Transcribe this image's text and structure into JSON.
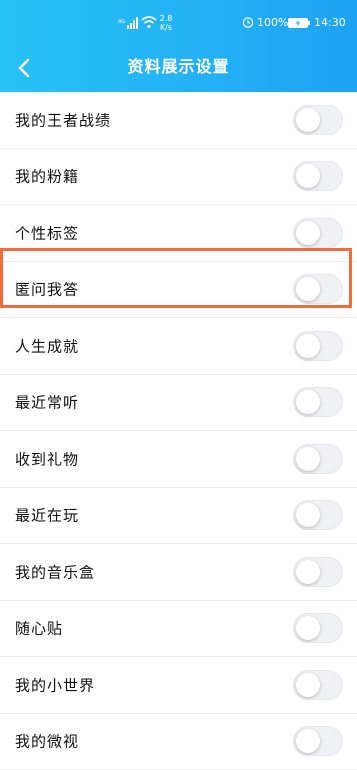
{
  "status_bar": {
    "speed_value": "2.8",
    "speed_unit": "K/s",
    "battery_percent": "100%",
    "time": "14:30"
  },
  "nav": {
    "title": "资料展示设置",
    "back_icon": "chevron-left-icon"
  },
  "settings": [
    {
      "label": "我的王者战绩",
      "enabled": false
    },
    {
      "label": "我的粉籍",
      "enabled": false
    },
    {
      "label": "个性标签",
      "enabled": false
    },
    {
      "label": "匿问我答",
      "enabled": false
    },
    {
      "label": "人生成就",
      "enabled": false
    },
    {
      "label": "最近常听",
      "enabled": false
    },
    {
      "label": "收到礼物",
      "enabled": false
    },
    {
      "label": "最近在玩",
      "enabled": false
    },
    {
      "label": "我的音乐盒",
      "enabled": false
    },
    {
      "label": "随心贴",
      "enabled": false
    },
    {
      "label": "我的小世界",
      "enabled": false
    },
    {
      "label": "我的微视",
      "enabled": false
    }
  ],
  "colors": {
    "header_gradient_start": "#27c2f5",
    "header_gradient_end": "#1ea2f2",
    "highlight_border": "#f36b3a",
    "toggle_off_track": "#f0f1f5"
  }
}
